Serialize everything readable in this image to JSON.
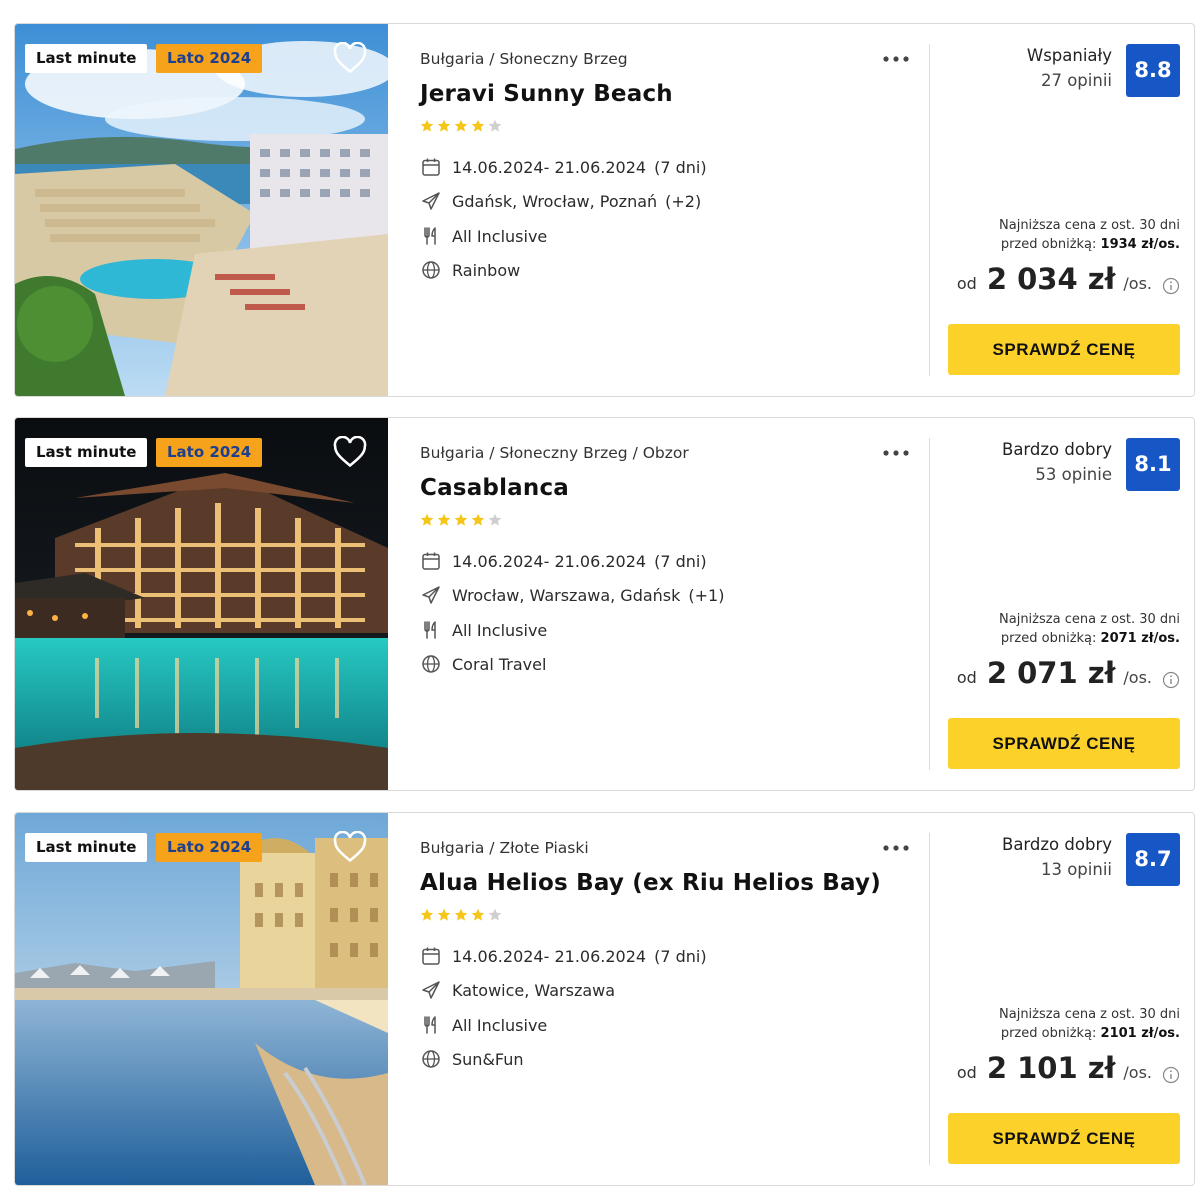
{
  "offers": [
    {
      "badge_last_minute": "Last minute",
      "badge_season": "Lato 2024",
      "location": "Bułgaria / Słoneczny Brzeg",
      "name": "Jeravi Sunny Beach",
      "stars": 4,
      "dates": "14.06.2024- 21.06.2024",
      "duration": "(7 dni)",
      "departures": "Gdańsk, Wrocław, Poznań",
      "departures_extra": "(+2)",
      "board": "All Inclusive",
      "operator": "Rainbow",
      "rating_label": "Wspaniały",
      "reviews": "27 opinii",
      "score": "8.8",
      "lowest_price_line1": "Najniższa cena z ost. 30 dni",
      "lowest_price_line2_prefix": "przed obniżką:",
      "lowest_price_value": "1934 zł/os.",
      "price_prefix": "od",
      "price": "2 034 zł",
      "price_suffix": "/os.",
      "cta": "SPRAWDŹ CENĘ"
    },
    {
      "badge_last_minute": "Last minute",
      "badge_season": "Lato 2024",
      "location": "Bułgaria / Słoneczny Brzeg / Obzor",
      "name": "Casablanca",
      "stars": 4,
      "dates": "14.06.2024- 21.06.2024",
      "duration": "(7 dni)",
      "departures": "Wrocław, Warszawa, Gdańsk",
      "departures_extra": "(+1)",
      "board": "All Inclusive",
      "operator": "Coral Travel",
      "rating_label": "Bardzo dobry",
      "reviews": "53 opinie",
      "score": "8.1",
      "lowest_price_line1": "Najniższa cena z ost. 30 dni",
      "lowest_price_line2_prefix": "przed obniżką:",
      "lowest_price_value": "2071 zł/os.",
      "price_prefix": "od",
      "price": "2 071 zł",
      "price_suffix": "/os.",
      "cta": "SPRAWDŹ CENĘ"
    },
    {
      "badge_last_minute": "Last minute",
      "badge_season": "Lato 2024",
      "location": "Bułgaria / Złote Piaski",
      "name": "Alua Helios Bay (ex Riu Helios Bay)",
      "stars": 4,
      "dates": "14.06.2024- 21.06.2024",
      "duration": "(7 dni)",
      "departures": "Katowice, Warszawa",
      "departures_extra": "",
      "board": "All Inclusive",
      "operator": "Sun&Fun",
      "rating_label": "Bardzo dobry",
      "reviews": "13 opinii",
      "score": "8.7",
      "lowest_price_line1": "Najniższa cena z ost. 30 dni",
      "lowest_price_line2_prefix": "przed obniżką:",
      "lowest_price_value": "2101 zł/os.",
      "price_prefix": "od",
      "price": "2 101 zł",
      "price_suffix": "/os.",
      "cta": "SPRAWDŹ CENĘ"
    }
  ],
  "colors": {
    "score_bg": "#1657c5",
    "cta_bg": "#fcd12a",
    "season_badge_bg": "#f6a21a",
    "star_filled": "#f5c518",
    "star_empty": "#cfcfcf"
  },
  "icons": {
    "calendar": "calendar-icon",
    "departure": "plane-icon",
    "board": "cutlery-icon",
    "operator": "globe-icon",
    "favorite": "heart-icon",
    "more": "more-dots-icon",
    "info": "info-icon"
  }
}
